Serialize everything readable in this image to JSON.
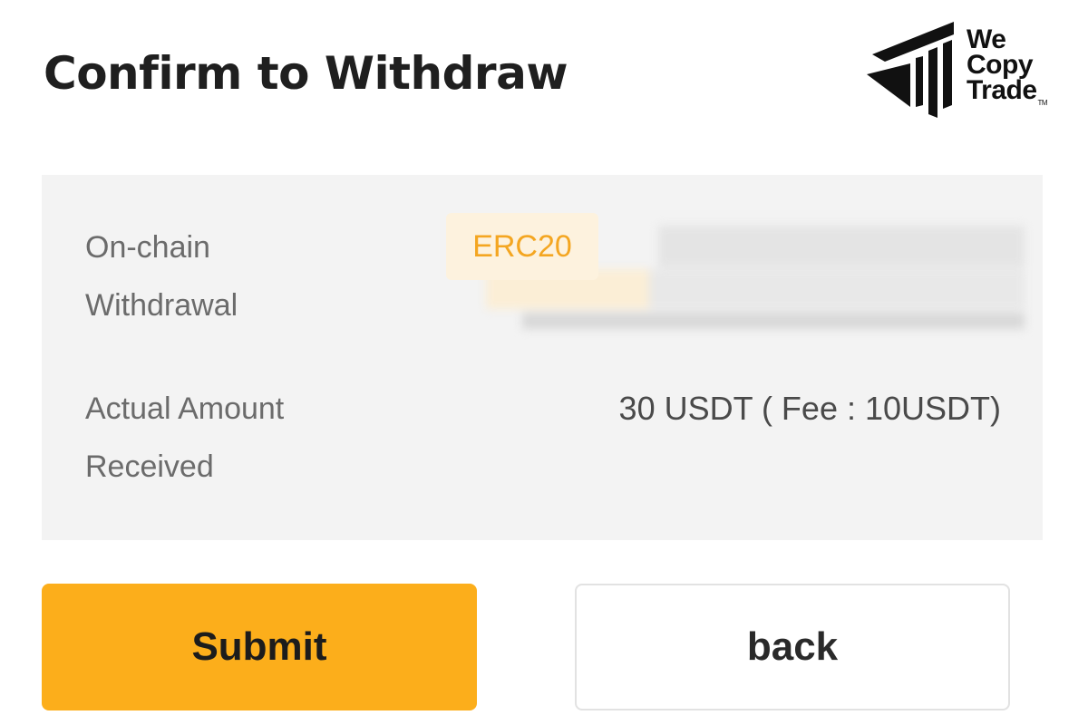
{
  "header": {
    "title": "Confirm to Withdraw"
  },
  "brand": {
    "line1": "We",
    "line2": "Copy",
    "line3": "Trade",
    "trademark": "TM",
    "logo_icon": "wecopytrade-logo-icon"
  },
  "details": {
    "chain_label_line1": "On-chain",
    "chain_label_line2": "Withdrawal",
    "network": "ERC20",
    "address_redacted": true,
    "amount_label_line1": "Actual Amount",
    "amount_label_line2": "Received",
    "amount_value": "30 USDT ( Fee : 10USDT)"
  },
  "actions": {
    "submit_label": "Submit",
    "back_label": "back"
  },
  "colors": {
    "accent": "#fcae1b",
    "badge_text": "#f4a621",
    "badge_bg": "#fdf2de",
    "panel_bg": "#f3f3f3"
  }
}
